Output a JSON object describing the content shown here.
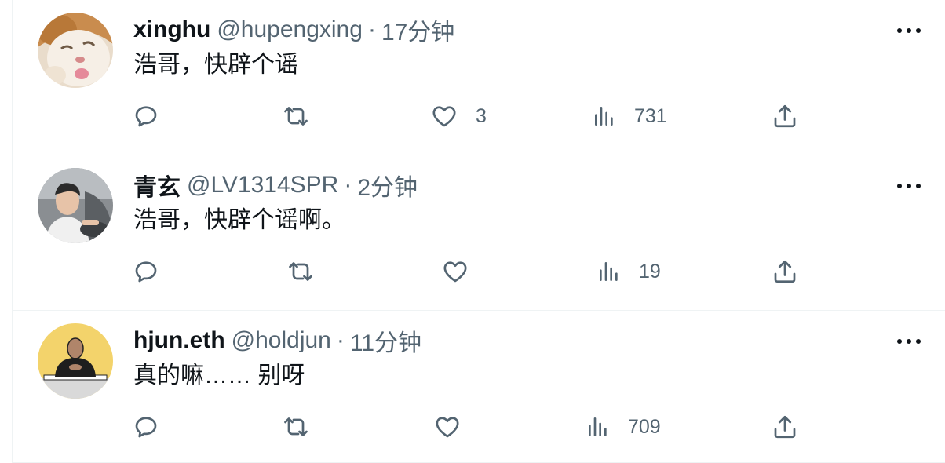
{
  "tweets": [
    {
      "name": "xinghu",
      "handle": "@hupengxing",
      "dot": "·",
      "time": "17分钟",
      "text": "浩哥，快辟个谣",
      "likes": "3",
      "views": "731",
      "avatar": "cat"
    },
    {
      "name": "青玄",
      "handle": "@LV1314SPR",
      "dot": "·",
      "time": "2分钟",
      "text": "浩哥，快辟个谣啊。",
      "likes": "",
      "views": "19",
      "avatar": "man-in-car"
    },
    {
      "name": "hjun.eth",
      "handle": "@holdjun",
      "dot": "·",
      "time": "11分钟",
      "text": "真的嘛…… 别呀",
      "likes": "",
      "views": "709",
      "avatar": "cartoon-person"
    }
  ],
  "icons": {
    "reply": "reply-icon",
    "retweet": "retweet-icon",
    "like": "heart-icon",
    "views": "views-icon",
    "share": "share-icon",
    "more": "more-icon"
  },
  "colors": {
    "text": "#0f1419",
    "secondary": "#536471",
    "divider": "#eff3f4",
    "avatar_yellow": "#f3d36b"
  }
}
